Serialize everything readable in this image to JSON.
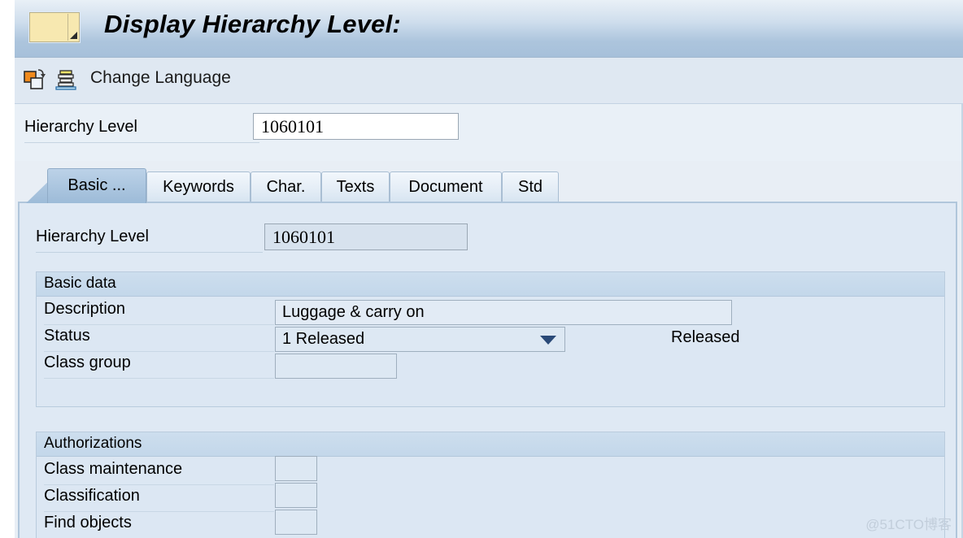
{
  "window": {
    "title": "Display Hierarchy Level:",
    "icon": "session-window-icon"
  },
  "toolbar": {
    "copy_icon": "copy-icon",
    "stack_icon": "layers-icon",
    "change_language_label": "Change Language"
  },
  "selection": {
    "label": "Hierarchy Level",
    "value": "1060101"
  },
  "tabs": [
    {
      "label": "Basic ...",
      "active": true
    },
    {
      "label": "Keywords",
      "active": false
    },
    {
      "label": "Char.",
      "active": false
    },
    {
      "label": "Texts",
      "active": false
    },
    {
      "label": "Document",
      "active": false
    },
    {
      "label": "Std",
      "active": false
    }
  ],
  "panel": {
    "label": "Hierarchy Level",
    "value": "1060101"
  },
  "basic_data": {
    "header": "Basic data",
    "rows": [
      {
        "label": "Description",
        "value": "Luggage & carry on",
        "type": "text"
      },
      {
        "label": "Status",
        "value": "1 Released",
        "type": "dropdown",
        "suffix": "Released"
      },
      {
        "label": "Class group",
        "value": "",
        "type": "text"
      }
    ]
  },
  "authorizations": {
    "header": "Authorizations",
    "rows": [
      {
        "label": "Class maintenance",
        "value": ""
      },
      {
        "label": "Classification",
        "value": ""
      },
      {
        "label": "Find objects",
        "value": ""
      }
    ]
  },
  "watermark": "@51CTO博客",
  "colors": {
    "titlebar_top": "#e9f0f7",
    "titlebar_bottom": "#a6c0da",
    "panel_bg": "#dfe9f4",
    "active_tab": "#a9c4de",
    "dropdown_arrow": "#2a4a78",
    "icon_orange": "#f08a1c",
    "icon_yellow": "#f2e36a"
  }
}
